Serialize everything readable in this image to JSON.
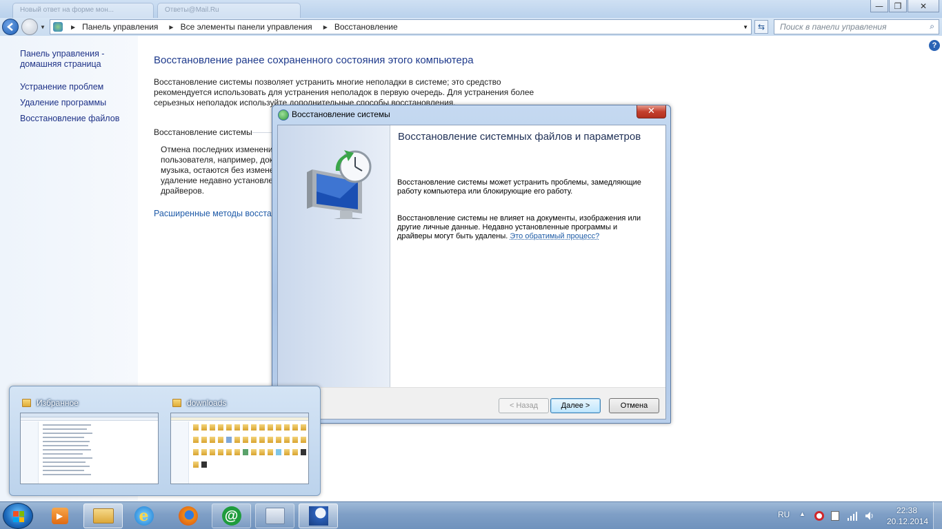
{
  "explorer": {
    "ghost_tabs": [
      "Новый ответ на форме мон...",
      "Ответы@Mail.Ru"
    ],
    "window_controls": {
      "minimize": "—",
      "maximize": "❐",
      "close": "✕"
    },
    "breadcrumbs": [
      "Панель управления",
      "Все элементы панели управления",
      "Восстановление"
    ],
    "search_placeholder": "Поиск в панели управления",
    "help_icon": "?"
  },
  "sidebar": {
    "items": [
      {
        "label": "Панель управления - домашняя страница"
      },
      {
        "label": "Устранение проблем"
      },
      {
        "label": "Удаление программы"
      },
      {
        "label": "Восстановление файлов"
      }
    ]
  },
  "main": {
    "title": "Восстановление ранее сохраненного состояния этого компьютера",
    "description": "Восстановление системы позволяет устранить многие неполадки в системе; это средство рекомендуется использовать для устранения неполадок в первую очередь. Для устранения более серьезных неполадок используйте дополнительные способы восстановления.",
    "section_title": "Восстановление системы",
    "section_desc": "Отмена последних изменений\nпользователя, например, док\nмузыка, остаются без измене\nудаление недавно установле\nдрайверов.",
    "advanced_link": "Расширенные методы восстановления"
  },
  "dialog": {
    "title": "Восстановление системы",
    "close": "✕",
    "heading": "Восстановление системных файлов и параметров",
    "paragraph1": "Восстановление системы может устранить проблемы, замедляющие работу компьютера или блокирующие его работу.",
    "paragraph2": "Восстановление системы не влияет на документы, изображения или другие личные данные. Недавно установленные программы и драйверы могут быть удалены.",
    "link": "Это обратимый процесс?",
    "buttons": {
      "back": "< Назад",
      "next": "Далее >",
      "cancel": "Отмена"
    }
  },
  "preview": {
    "windows": [
      {
        "title": "Избранное"
      },
      {
        "title": "downloads"
      }
    ]
  },
  "taskbar": {
    "apps": [
      "media-player",
      "explorer",
      "internet-explorer",
      "firefox",
      "mail-agent",
      "control-panel",
      "system-restore"
    ],
    "language": "RU",
    "time": "22:38",
    "date": "20.12.2014"
  },
  "colors": {
    "link": "#1e3287",
    "title": "#1e3a8c",
    "accent": "#2b63b5"
  }
}
